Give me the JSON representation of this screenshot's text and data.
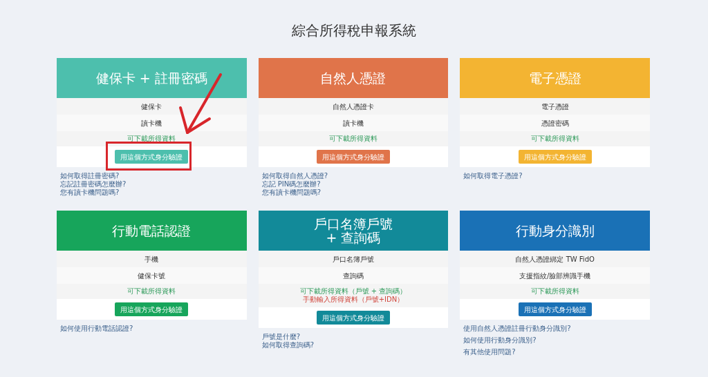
{
  "page_title": "綜合所得稅申報系統",
  "cards": [
    {
      "title_lines": [
        "健保卡 + 註冊密碼"
      ],
      "color": "#4dbfad",
      "rows": [
        "健保卡",
        "讀卡機"
      ],
      "notes": [
        {
          "text": "可下載所得資料",
          "kind": "download"
        }
      ],
      "button": "用這個方式身分驗證",
      "links": [
        "如何取得註冊密碼?",
        "忘記註冊密碼怎麼辦?",
        "您有讀卡機問題嗎?"
      ]
    },
    {
      "title_lines": [
        "自然人憑證"
      ],
      "color": "#e0744a",
      "rows": [
        "自然人憑證卡",
        "讀卡機"
      ],
      "notes": [
        {
          "text": "可下載所得資料",
          "kind": "download"
        }
      ],
      "button": "用這個方式身分驗證",
      "links": [
        "如何取得自然人憑證?",
        "忘記 PIN碼怎麼辦?",
        "您有讀卡機問題嗎?"
      ]
    },
    {
      "title_lines": [
        "電子憑證"
      ],
      "color": "#f3b432",
      "rows": [
        "電子憑證",
        "憑證密碼"
      ],
      "notes": [
        {
          "text": "可下載所得資料",
          "kind": "download"
        }
      ],
      "button": "用這個方式身分驗證",
      "links": [
        "如何取得電子憑證?"
      ]
    },
    {
      "title_lines": [
        "行動電話認證"
      ],
      "color": "#17a55b",
      "rows": [
        "手機",
        "健保卡號"
      ],
      "notes": [
        {
          "text": "可下載所得資料",
          "kind": "download"
        }
      ],
      "button": "用這個方式身分驗證",
      "links": [
        "如何使用行動電話認證?"
      ]
    },
    {
      "title_lines": [
        "戶口名簿戶號",
        "+ 查詢碼"
      ],
      "color": "#128a99",
      "rows": [
        "戶口名簿戶號",
        "查詢碼"
      ],
      "notes": [
        {
          "text": "可下載所得資料（戶號 + 查詢碼）",
          "kind": "download"
        },
        {
          "text": "手動輸入所得資料（戶號+IDN）",
          "kind": "manual"
        }
      ],
      "button": "用這個方式身分驗證",
      "links": [
        "戶號是什麼?",
        "如何取得查詢碼?"
      ]
    },
    {
      "title_lines": [
        "行動身分識別"
      ],
      "color": "#1a71b6",
      "rows": [
        "自然人憑證綁定 TW FidO",
        "支援指紋/臉部辨識手機"
      ],
      "notes": [
        {
          "text": "可下載所得資料",
          "kind": "download"
        }
      ],
      "button": "用這個方式身分驗證",
      "links": [
        "使用自然人憑證註冊行動身分識別?",
        "如何使用行動身分識別?",
        "有其他使用問題?"
      ]
    }
  ]
}
